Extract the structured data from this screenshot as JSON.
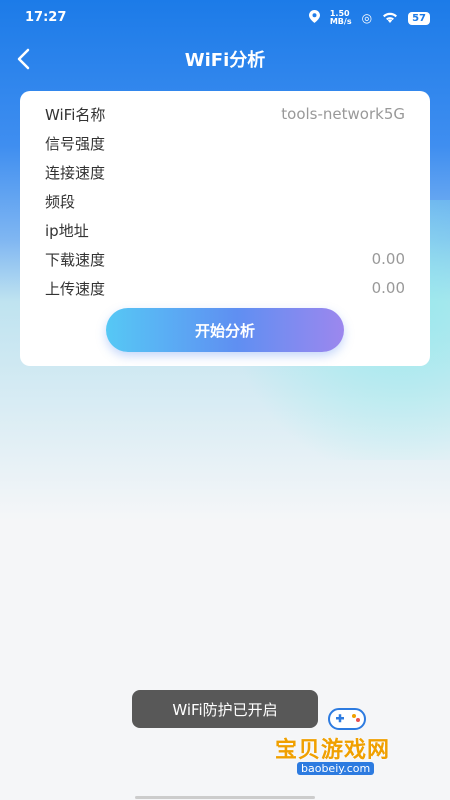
{
  "status_bar": {
    "time": "17:27",
    "net_speed_value": "1.50",
    "net_speed_unit": "MB/s",
    "battery": "57"
  },
  "header": {
    "title": "WiFi分析",
    "back_icon": "chevron-left-icon"
  },
  "info": {
    "rows": [
      {
        "label": "WiFi名称",
        "value": "tools-network5G"
      },
      {
        "label": "信号强度",
        "value": ""
      },
      {
        "label": "连接速度",
        "value": ""
      },
      {
        "label": "频段",
        "value": ""
      },
      {
        "label": "ip地址",
        "value": ""
      },
      {
        "label": "下载速度",
        "value": "0.00"
      },
      {
        "label": "上传速度",
        "value": "0.00"
      }
    ],
    "analyze_button": "开始分析"
  },
  "toast": "WiFi防护已开启",
  "watermark": {
    "text": "宝贝游戏网",
    "url": "baobeiy.com"
  },
  "colors": {
    "primary": "#1c7be8",
    "button_start": "#56c8f5",
    "button_end": "#9c87ee"
  }
}
